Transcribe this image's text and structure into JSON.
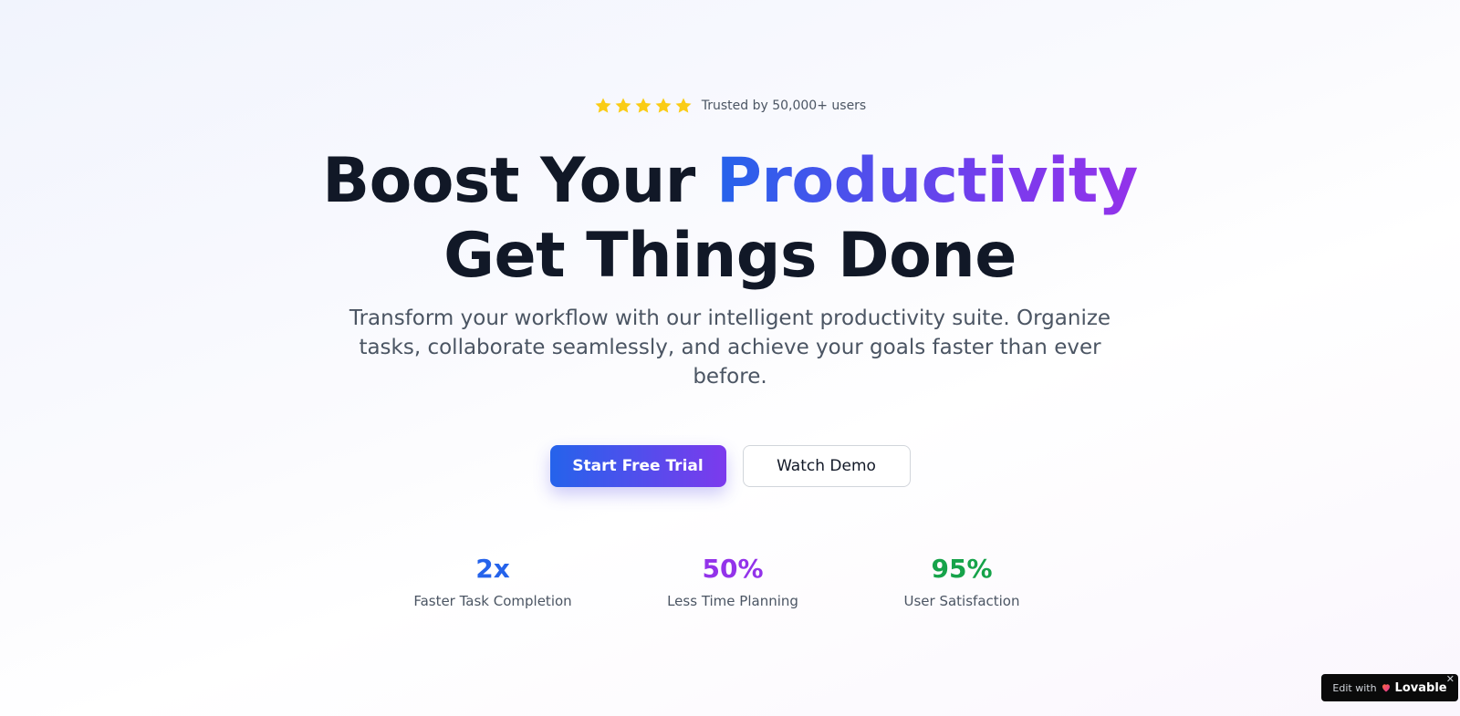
{
  "trust": {
    "stars": 5,
    "star_color": "#facc15",
    "text": "Trusted by 50,000+ users"
  },
  "headline": {
    "line1_prefix": "Boost Your",
    "line1_highlight": "Productivity",
    "line2": "Get Things Done",
    "highlight_gradient": [
      "#2563eb",
      "#9333ea"
    ]
  },
  "subtitle": "Transform your workflow with our intelligent productivity suite. Organize tasks, collaborate seamlessly, and achieve your goals faster than ever before.",
  "cta": {
    "primary_label": "Start Free Trial",
    "secondary_label": "Watch Demo"
  },
  "stats": [
    {
      "value": "2x",
      "label": "Faster Task Completion",
      "color": "#2563eb"
    },
    {
      "value": "50%",
      "label": "Less Time Planning",
      "color": "#9333ea"
    },
    {
      "value": "95%",
      "label": "User Satisfaction",
      "color": "#16a34a"
    }
  ],
  "badge": {
    "edit_text": "Edit with",
    "brand": "Lovable",
    "close_symbol": "✕",
    "icon": "heart-icon"
  }
}
